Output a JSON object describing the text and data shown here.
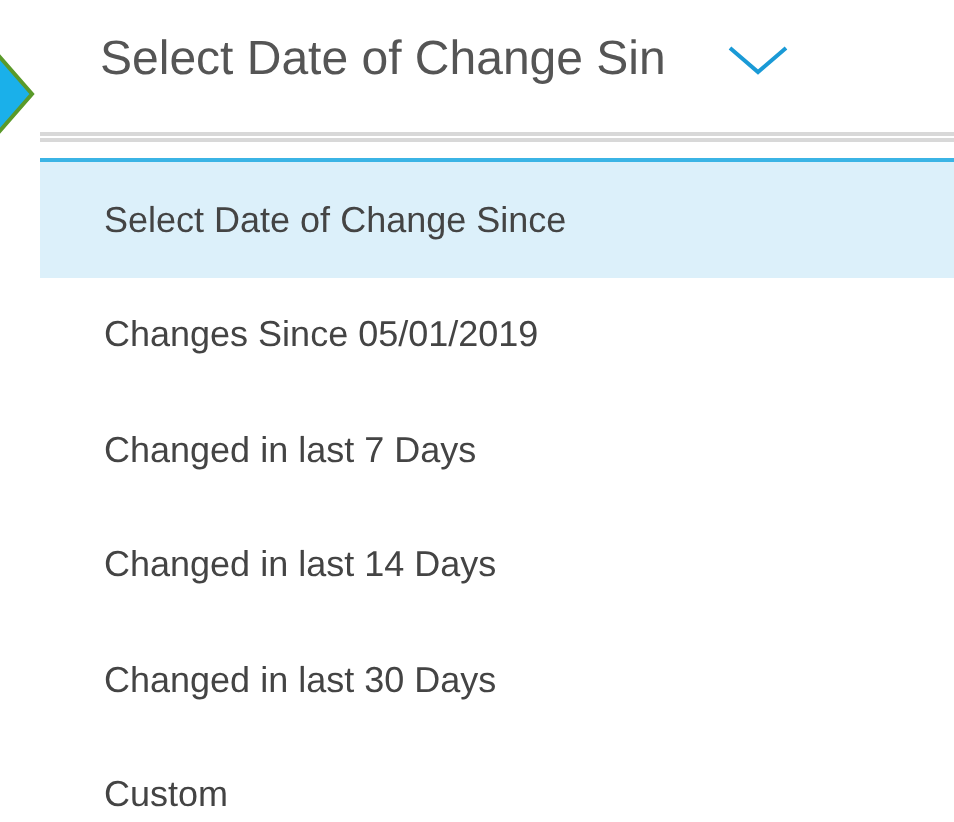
{
  "select": {
    "value": "Select Date of Change Sin"
  },
  "options": [
    {
      "label": "Select Date of Change Since",
      "selected": true
    },
    {
      "label": "Changes Since 05/01/2019",
      "selected": false
    },
    {
      "label": "Changed in last 7 Days",
      "selected": false
    },
    {
      "label": "Changed in last 14 Days",
      "selected": false
    },
    {
      "label": "Changed in last 30 Days",
      "selected": false
    },
    {
      "label": "Custom",
      "selected": false
    }
  ]
}
